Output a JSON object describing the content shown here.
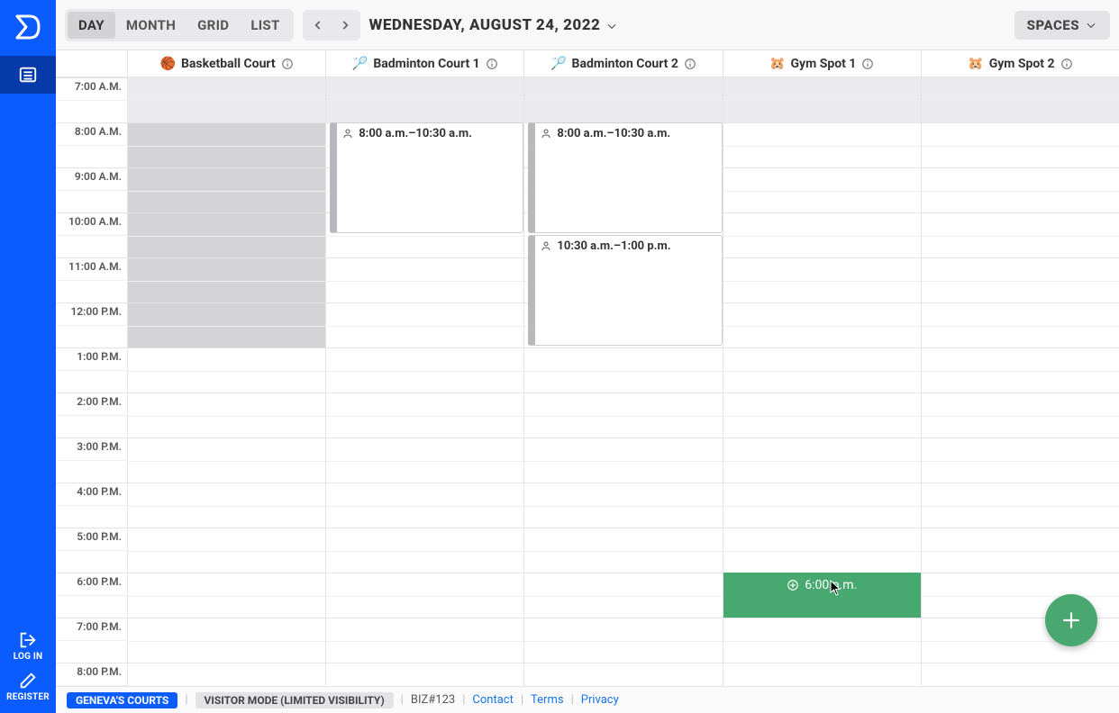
{
  "sidebar": {
    "login_label": "LOG IN",
    "register_label": "REGISTER"
  },
  "topbar": {
    "views": {
      "day": "DAY",
      "month": "MONTH",
      "grid": "GRID",
      "list": "LIST"
    },
    "active_view": "DAY",
    "date_label": "WEDNESDAY, AUGUST 24, 2022",
    "spaces_label": "SPACES"
  },
  "columns": [
    {
      "emoji": "🏀",
      "title": "Basketball Court"
    },
    {
      "emoji": "🏸",
      "title": "Badminton Court 1"
    },
    {
      "emoji": "🏸",
      "title": "Badminton Court 2"
    },
    {
      "emoji": "🐹",
      "title": "Gym Spot 1"
    },
    {
      "emoji": "🐹",
      "title": "Gym Spot 2"
    }
  ],
  "times": [
    "7:00 A.M.",
    "8:00 A.M.",
    "9:00 A.M.",
    "10:00 A.M.",
    "11:00 A.M.",
    "12:00 P.M.",
    "1:00 P.M.",
    "2:00 P.M.",
    "3:00 P.M.",
    "4:00 P.M.",
    "5:00 P.M.",
    "6:00 P.M.",
    "7:00 P.M.",
    "8:00 P.M."
  ],
  "events": {
    "bad1": {
      "time": "8:00 a.m.–10:30 a.m."
    },
    "bad2a": {
      "time": "8:00 a.m.–10:30 a.m."
    },
    "bad2b": {
      "time": "10:30 a.m.–1:00 p.m."
    }
  },
  "new_slot": {
    "label": "6:00 p.m."
  },
  "status": {
    "org": "GENEVA'S COURTS",
    "mode": "VISITOR MODE (LIMITED VISIBILITY)",
    "biz": "BIZ#123",
    "contact": "Contact",
    "terms": "Terms",
    "privacy": "Privacy"
  }
}
